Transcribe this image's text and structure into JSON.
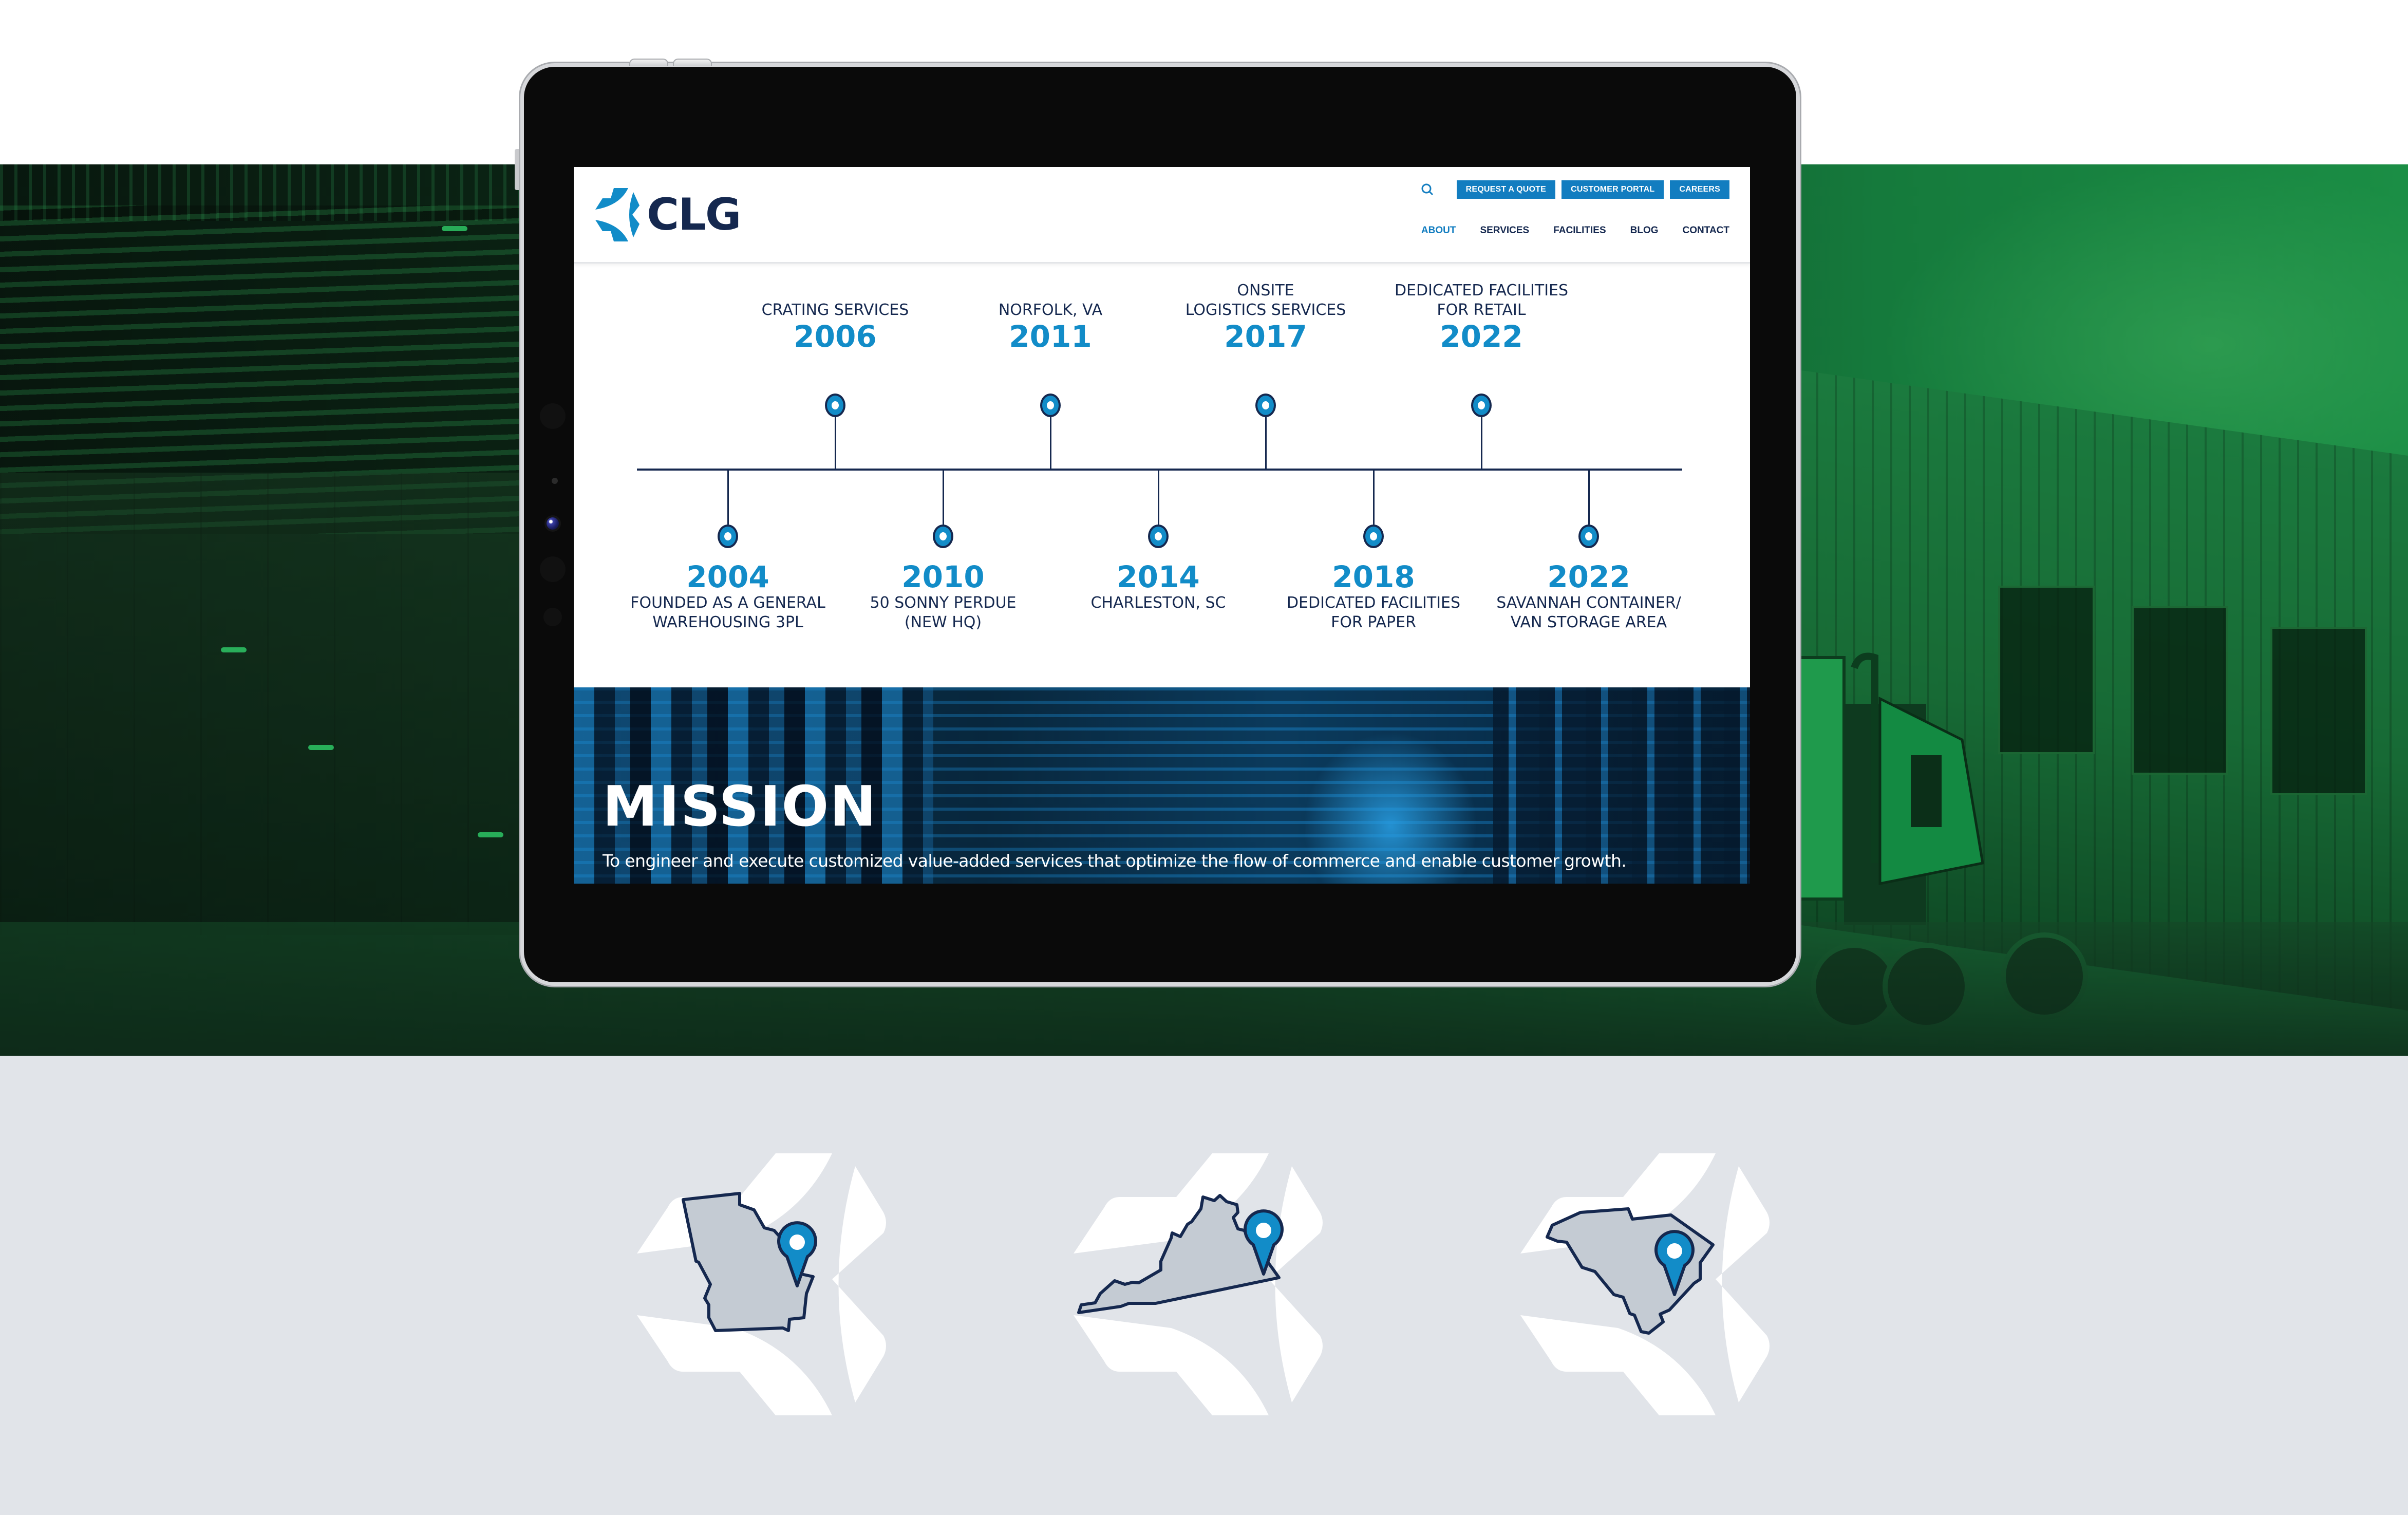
{
  "colors": {
    "brand_navy": "#15284f",
    "brand_blue": "#128cc8",
    "button_blue": "#127dc0",
    "hero_green": "#1b8e45",
    "bottom_gray": "#e1e4e9"
  },
  "site": {
    "logo_text": "CLG",
    "utility_buttons": [
      {
        "label": "REQUEST A QUOTE",
        "icon": "none"
      },
      {
        "label": "CUSTOMER PORTAL",
        "icon": "none"
      },
      {
        "label": "CAREERS",
        "icon": "none"
      }
    ],
    "search_icon": "search-icon",
    "nav": [
      {
        "label": "ABOUT",
        "active": true
      },
      {
        "label": "SERVICES",
        "active": false
      },
      {
        "label": "FACILITIES",
        "active": false
      },
      {
        "label": "BLOG",
        "active": false
      },
      {
        "label": "CONTACT",
        "active": false
      }
    ]
  },
  "timeline": {
    "top": [
      {
        "year": "2006",
        "label": [
          "CRATING SERVICES"
        ]
      },
      {
        "year": "2011",
        "label": [
          "NORFOLK, VA"
        ]
      },
      {
        "year": "2017",
        "label": [
          "ONSITE",
          "LOGISTICS SERVICES"
        ]
      },
      {
        "year": "2022",
        "label": [
          "DEDICATED FACILITIES",
          "FOR RETAIL"
        ]
      }
    ],
    "bottom": [
      {
        "year": "2004",
        "label": [
          "FOUNDED AS A GENERAL",
          "WAREHOUSING 3PL"
        ]
      },
      {
        "year": "2010",
        "label": [
          "50 SONNY PERDUE",
          "(NEW HQ)"
        ]
      },
      {
        "year": "2014",
        "label": [
          "CHARLESTON, SC"
        ]
      },
      {
        "year": "2018",
        "label": [
          "DEDICATED FACILITIES",
          "FOR PAPER"
        ]
      },
      {
        "year": "2022",
        "label": [
          "SAVANNAH CONTAINER/",
          "VAN STORAGE AREA"
        ]
      }
    ]
  },
  "mission": {
    "title": "MISSION",
    "text": "To engineer and execute customized value-added services that optimize the flow of commerce and enable customer growth."
  },
  "state_icons": [
    {
      "state": "Georgia",
      "icon": "georgia-map-pin-icon"
    },
    {
      "state": "Virginia",
      "icon": "virginia-map-pin-icon"
    },
    {
      "state": "South Carolina",
      "icon": "south-carolina-map-pin-icon"
    }
  ]
}
